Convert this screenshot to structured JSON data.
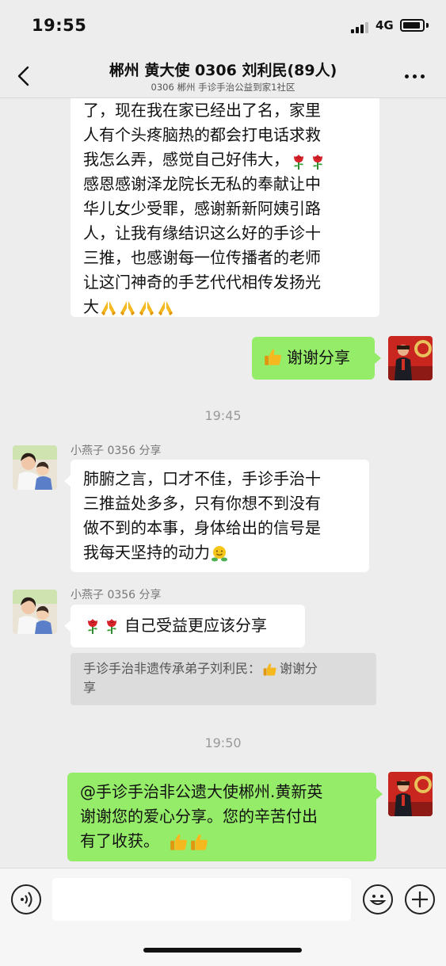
{
  "status_bar": {
    "time": "19:55",
    "network": "4G"
  },
  "header": {
    "title": "郴州 黄大使 0306 刘利民(89人)",
    "subtitle": "0306 郴州 手诊手治公益到家1社区"
  },
  "messages": {
    "m1": {
      "lines": [
        "了，现在我在家已经出了名，家里",
        "人有个头疼脑热的都会打电话求救",
        "我怎么弄，感觉自己好伟大，",
        "感恩感谢泽龙院长无私的奉献让中",
        "华儿女少受罪，感谢新新阿姨引路",
        "人，让我有缘结识这么好的手诊十",
        "三推，也感谢每一位传播者的老师",
        "让这门神奇的手艺代代相传发扬光",
        "大"
      ]
    },
    "m2": {
      "text": "谢谢分享"
    },
    "time1": "19:45",
    "m3": {
      "sender": "小燕子 0356 分享",
      "lines": [
        "肺腑之言，口才不佳，手诊手治十",
        "三推益处多多，只有你想不到没有",
        "做不到的本事，身体给出的信号是",
        "我每天坚持的动力"
      ]
    },
    "m4": {
      "sender": "小燕子 0356 分享",
      "text": "自己受益更应该分享",
      "quote_line1": "手诊手治非遗传承弟子刘利民：",
      "quote_line1b": "谢谢分",
      "quote_line2": "享"
    },
    "time2": "19:50",
    "m5": {
      "lines": [
        "@手诊手治非公遗大使郴州.黄新英",
        "谢谢您的爱心分享。您的辛苦付出",
        "有了收获。"
      ]
    }
  },
  "icons": {
    "rose": "rose-emoji",
    "pray": "folded-hands-emoji",
    "thumbs_up": "thumbs-up-emoji",
    "hug": "hugging-face-emoji"
  },
  "colors": {
    "background": "#ededed",
    "outgoing_bubble": "#95ec69",
    "incoming_bubble": "#ffffff"
  }
}
